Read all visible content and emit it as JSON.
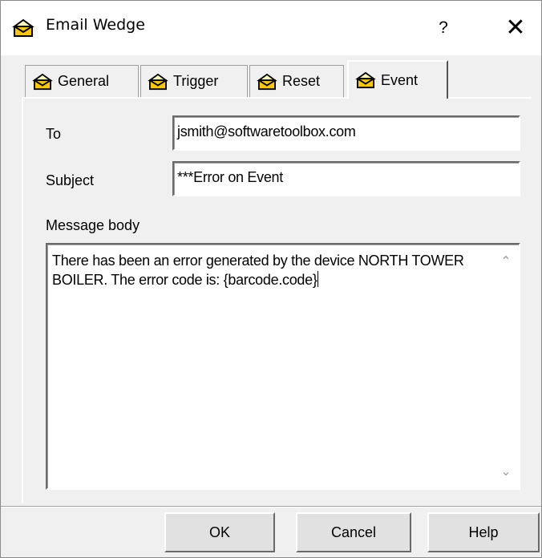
{
  "window": {
    "title": "Email Wedge",
    "help_label": "?",
    "close_label": "✕"
  },
  "tabs": [
    {
      "label": "General"
    },
    {
      "label": "Trigger"
    },
    {
      "label": "Reset"
    },
    {
      "label": "Event"
    }
  ],
  "form": {
    "to_label": "To",
    "to_value": "jsmith@softwaretoolbox.com",
    "subject_label": "Subject",
    "subject_value": "***Error on Event",
    "message_label": "Message body",
    "message_value": "There has been an error generated by the device NORTH TOWER BOILER. The error code is: {barcode.code}"
  },
  "buttons": {
    "ok": "OK",
    "cancel": "Cancel",
    "help": "Help"
  },
  "colors": {
    "window_bg": "#f0f0f0",
    "titlebar_bg": "#ffffff",
    "icon_fill": "#f5c518"
  },
  "icons": {
    "tab_icon": "envelope-icon",
    "app_icon": "envelope-icon"
  }
}
